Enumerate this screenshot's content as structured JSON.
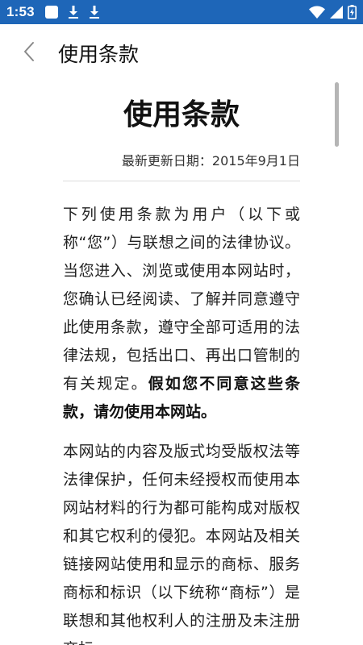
{
  "status_bar": {
    "time": "1:53",
    "left_icons": [
      "square-notification-icon",
      "download-icon",
      "download-icon"
    ],
    "right_icons": [
      "wifi-icon",
      "signal-icon",
      "battery-charging-icon"
    ],
    "background": "#1e66b8"
  },
  "app_bar": {
    "back_icon": "chevron-left-icon",
    "title": "使用条款"
  },
  "article": {
    "heading": "使用条款",
    "updated": "最新更新日期：2015年9月1日",
    "para1_text": "下列使用条款为用户（以下或称“您”）与联想之间的法律协议。当您进入、浏览或使用本网站时，您确认已经阅读、了解并同意遵守此使用条款，遵守全部可适用的法律法规，包括出口、再出口管制的有关规定。",
    "para1_bold": "假如您不同意这些条款，请勿使用本网站。",
    "para2_text": "本网站的内容及版式均受版权法等法律保护，任何未经授权而使用本网站材料的行为都可能构成对版权和其它权利的侵犯。本网站及相关链接网站使用和显示的商标、服务商标和标识（以下统称“商标”）是联想和其他权利人的注册及未注册商标。"
  }
}
